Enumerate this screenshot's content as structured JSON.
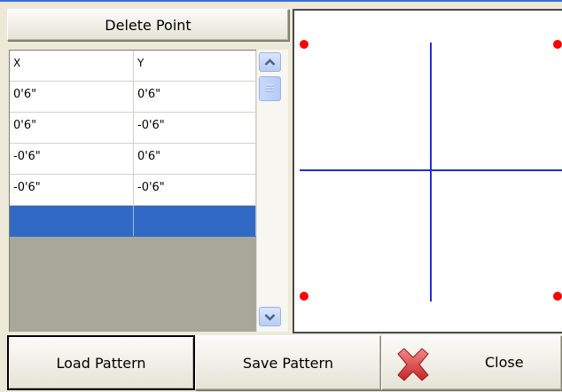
{
  "toolbar": {
    "delete_label": "Delete Point"
  },
  "grid": {
    "columns": [
      "X",
      "Y"
    ],
    "rows": [
      [
        "0'6\"",
        "0'6\""
      ],
      [
        "0'6\"",
        "-0'6\""
      ],
      [
        "-0'6\"",
        "0'6\""
      ],
      [
        "-0'6\"",
        "-0'6\""
      ],
      [
        "",
        ""
      ]
    ]
  },
  "scrollbar": {
    "up_icon": "chevron-up-icon",
    "down_icon": "chevron-down-icon"
  },
  "preview": {
    "axis_color": "#1f2fd8",
    "point_color": "#ff0000",
    "points": [
      [
        0.5,
        0.5
      ],
      [
        0.5,
        -0.5
      ],
      [
        -0.5,
        0.5
      ],
      [
        -0.5,
        -0.5
      ]
    ]
  },
  "buttons": {
    "load_label": "Load Pattern",
    "save_label": "Save Pattern",
    "close_label": "Close",
    "close_icon": "close-icon"
  },
  "colors": {
    "selection": "#316ac5",
    "window_bg": "#ece9d8"
  }
}
